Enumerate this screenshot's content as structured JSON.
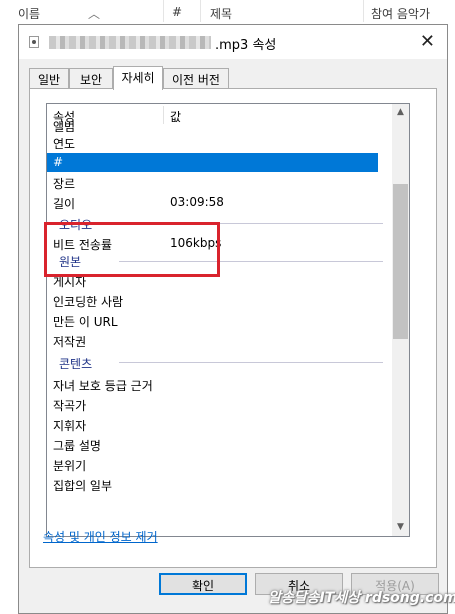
{
  "background_list": {
    "col_name": "이름",
    "col_track": "#",
    "col_title": "제목",
    "col_artist": "참여 음악가"
  },
  "dialog": {
    "title_suffix": ".mp3 속성",
    "close": "✕"
  },
  "tabs": [
    {
      "label": "일반"
    },
    {
      "label": "보안"
    },
    {
      "label": "자세히"
    },
    {
      "label": "이전 버전"
    }
  ],
  "properties": {
    "header": {
      "prop": "속성",
      "value": "값"
    },
    "rows": {
      "album": {
        "name": "앨범",
        "value": ""
      },
      "year": {
        "name": "연도",
        "value": ""
      },
      "track": {
        "name": "#",
        "value": ""
      },
      "genre": {
        "name": "장르",
        "value": ""
      },
      "length": {
        "name": "길이",
        "value": "03:09:58"
      },
      "bitrate": {
        "name": "비트 전송률",
        "value": "106kbps"
      },
      "publisher": {
        "name": "게시자"
      },
      "encoded_by": {
        "name": "인코딩한 사람"
      },
      "author_url": {
        "name": "만든 이 URL"
      },
      "copyright": {
        "name": "저작권"
      },
      "parental": {
        "name": "자녀 보호 등급 근거"
      },
      "composer": {
        "name": "작곡가"
      },
      "conductor": {
        "name": "지휘자"
      },
      "group_desc": {
        "name": "그룹 설명"
      },
      "mood": {
        "name": "분위기"
      },
      "part_of_set": {
        "name": "집합의 일부"
      }
    },
    "groups": {
      "audio": "오디오",
      "origin": "원본",
      "content": "콘텐츠"
    }
  },
  "remove_link": "속성 및 개인 정보 제거",
  "buttons": {
    "ok": "확인",
    "cancel": "취소",
    "apply": "적용(A)"
  },
  "watermark": "알송달송IT세상 rdsong.com",
  "colors": {
    "selection": "#0078d7",
    "highlight_box": "#d9232d",
    "group_text": "#1e3287",
    "link": "#0066cc"
  }
}
